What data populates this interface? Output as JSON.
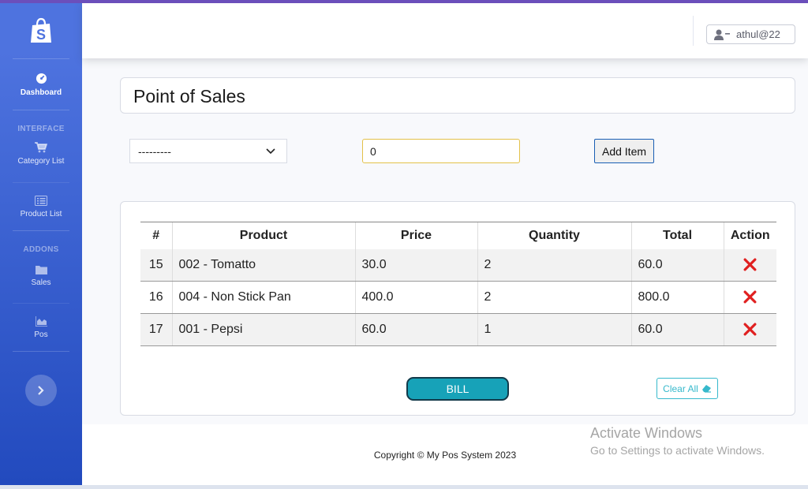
{
  "sidebar": {
    "brand_icon": "shopping-bag-icon",
    "items": [
      {
        "label": "Dashboard",
        "icon": "tachometer-icon"
      },
      {
        "label": "Category List",
        "icon": "cart-icon"
      },
      {
        "label": "Product List",
        "icon": "list-icon"
      },
      {
        "label": "Sales",
        "icon": "folder-icon"
      },
      {
        "label": "Pos",
        "icon": "chart-area-icon"
      }
    ],
    "headings": {
      "interface": "INTERFACE",
      "addons": "ADDONS"
    },
    "toggle_icon": "chevron-right-icon"
  },
  "topbar": {
    "username": "athul@22",
    "user_icon": "user-minus-icon"
  },
  "page": {
    "title": "Point of Sales"
  },
  "form": {
    "product_select_value": "---------",
    "quantity_value": "0",
    "add_button": "Add Item"
  },
  "table": {
    "headers": [
      "#",
      "Product",
      "Price",
      "Quantity",
      "Total",
      "Action"
    ],
    "rows": [
      {
        "id": "15",
        "product": "002 - Tomatto",
        "price": "30.0",
        "quantity": "2",
        "total": "60.0"
      },
      {
        "id": "16",
        "product": "004 - Non Stick Pan",
        "price": "400.0",
        "quantity": "2",
        "total": "800.0"
      },
      {
        "id": "17",
        "product": "001 - Pepsi",
        "price": "60.0",
        "quantity": "1",
        "total": "60.0"
      }
    ],
    "delete_icon": "close-icon"
  },
  "actions": {
    "bill": "BILL",
    "clear_all": "Clear All",
    "clear_icon": "eraser-icon"
  },
  "footer": {
    "copyright": "Copyright © My Pos System 2023"
  },
  "watermark": {
    "line1": "Activate Windows",
    "line2": "Go to Settings to activate Windows."
  },
  "colors": {
    "sidebar_top": "#4e73df",
    "sidebar_bottom": "#224abe",
    "bill": "#17a2b8",
    "delete": "#e02020",
    "accent_stripe": "#6b4fbb"
  }
}
